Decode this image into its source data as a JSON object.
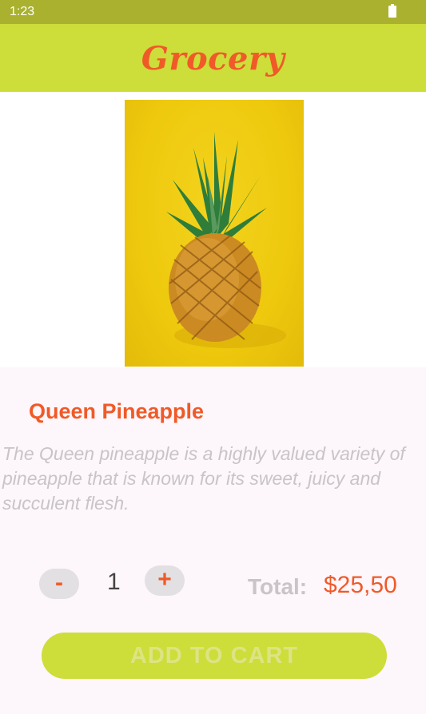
{
  "status_bar": {
    "time": "1:23",
    "battery_icon": "battery-full-icon"
  },
  "app_bar": {
    "title": "Grocery"
  },
  "product": {
    "image_icon": "pineapple-photo",
    "name": "Queen Pineapple",
    "description": "The Queen pineapple is a highly valued variety of pineapple that is known for its sweet, juicy and succulent flesh."
  },
  "quantity": {
    "minus_label": "-",
    "value": "1",
    "plus_label": "+"
  },
  "total": {
    "label": "Total:",
    "value": "$25,50"
  },
  "actions": {
    "add_to_cart_label": "ADD TO CART"
  },
  "colors": {
    "status_bar": "#a9b12f",
    "app_bar": "#cddd3a",
    "accent": "#f05a28",
    "muted_text": "#c8c4c8",
    "button_bg": "#cddd3a"
  }
}
